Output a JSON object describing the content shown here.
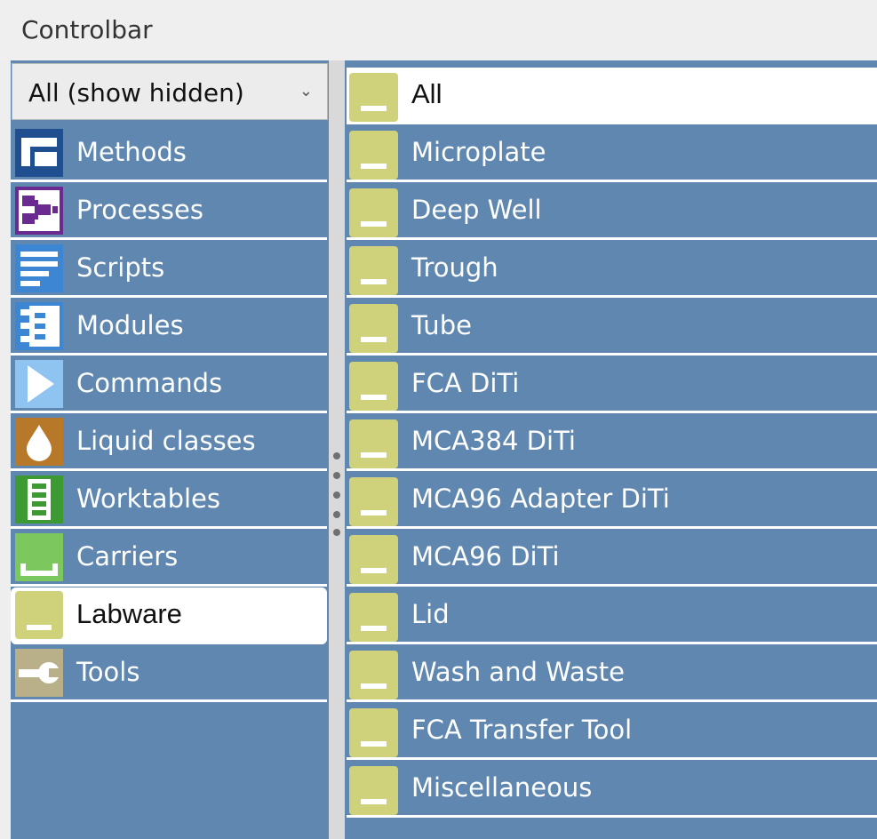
{
  "window": {
    "title": "Controlbar"
  },
  "filter": {
    "selected": "All (show hidden)"
  },
  "nav": {
    "items": [
      {
        "label": "Methods",
        "icon": "methods-icon",
        "color": "#1f4f8f"
      },
      {
        "label": "Processes",
        "icon": "processes-icon",
        "color": "#6a2a8f"
      },
      {
        "label": "Scripts",
        "icon": "scripts-icon",
        "color": "#3c86d4"
      },
      {
        "label": "Modules",
        "icon": "modules-icon",
        "color": "#3c86d4"
      },
      {
        "label": "Commands",
        "icon": "commands-icon",
        "color": "#8fc3f0"
      },
      {
        "label": "Liquid classes",
        "icon": "liquid-drop-icon",
        "color": "#b8782a"
      },
      {
        "label": "Worktables",
        "icon": "worktable-icon",
        "color": "#3d9a33"
      },
      {
        "label": "Carriers",
        "icon": "carrier-icon",
        "color": "#7cc85e"
      },
      {
        "label": "Labware",
        "icon": "labware-icon",
        "color": "#cfd27a",
        "selected": true
      },
      {
        "label": "Tools",
        "icon": "wrench-icon",
        "color": "#b9b08a"
      }
    ]
  },
  "categories": {
    "items": [
      {
        "label": "All",
        "selected": true
      },
      {
        "label": "Microplate"
      },
      {
        "label": "Deep Well"
      },
      {
        "label": "Trough"
      },
      {
        "label": "Tube"
      },
      {
        "label": "FCA DiTi"
      },
      {
        "label": "MCA384 DiTi"
      },
      {
        "label": "MCA96 Adapter DiTi"
      },
      {
        "label": "MCA96 DiTi"
      },
      {
        "label": "Lid"
      },
      {
        "label": "Wash and Waste"
      },
      {
        "label": "FCA Transfer Tool"
      },
      {
        "label": "Miscellaneous"
      }
    ]
  },
  "colors": {
    "panel": "#5f87b0",
    "labware_icon": "#cfd27a",
    "selected_bg": "#ffffff"
  }
}
